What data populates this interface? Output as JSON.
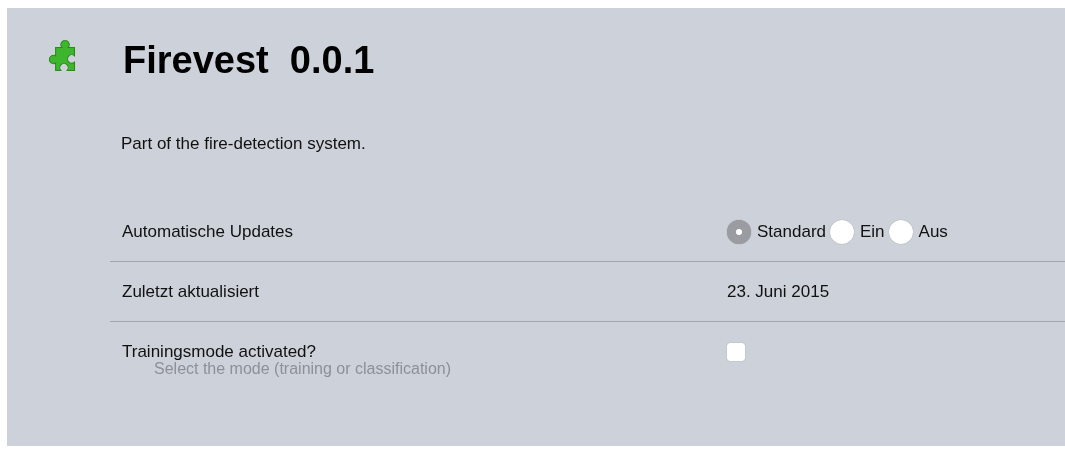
{
  "addon": {
    "name": "Firevest",
    "version": "0.0.1",
    "description": "Part of the fire-detection system."
  },
  "settings": [
    {
      "kind": "radio",
      "label": "Automatische Updates",
      "options": [
        {
          "label": "Standard",
          "selected": true
        },
        {
          "label": "Ein",
          "selected": false
        },
        {
          "label": "Aus",
          "selected": false
        }
      ]
    },
    {
      "kind": "text",
      "label": "Zuletzt aktualisiert",
      "value": "23. Juni 2015"
    },
    {
      "kind": "checkbox",
      "label": "Trainingsmode activated?",
      "checked": false,
      "hint": "Select the mode (training or classification)"
    }
  ]
}
